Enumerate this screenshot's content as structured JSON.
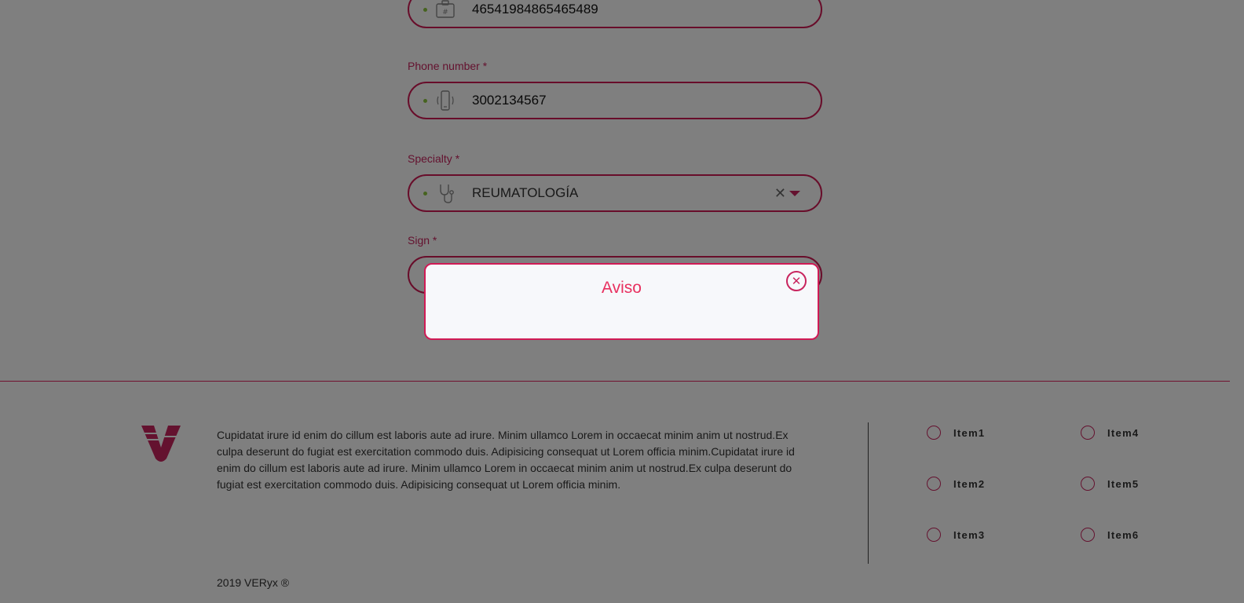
{
  "form": {
    "id_field": {
      "value": "46541984865465489",
      "icon": "id-card-icon"
    },
    "phone": {
      "label": "Phone number *",
      "value": "3002134567",
      "icon": "phone-icon"
    },
    "specialty": {
      "label": "Specialty *",
      "value": "REUMATOLOGÍA",
      "icon": "stethoscope-icon",
      "clear_glyph": "✕"
    },
    "sign": {
      "label": "Sign *"
    }
  },
  "modal": {
    "title": "Aviso",
    "close_glyph": "✕"
  },
  "footer": {
    "text": "Cupidatat irure id enim do cillum est laboris aute ad irure. Minim ullamco Lorem in occaecat minim anim ut nostrud.Ex culpa deserunt do fugiat est exercitation commodo duis. Adipisicing consequat ut Lorem officia minim.Cupidatat irure id enim do cillum est laboris aute ad irure. Minim ullamco Lorem in occaecat minim anim ut nostrud.Ex culpa deserunt do fugiat est exercitation commodo duis. Adipisicing consequat ut Lorem officia minim.",
    "items": [
      "Item1",
      "Item2",
      "Item3",
      "Item4",
      "Item5",
      "Item6"
    ],
    "copyright": "2019 VERyx ®"
  },
  "colors": {
    "accent": "#d01a55",
    "bullet": "#8cc63f",
    "modal_title": "#e8305f"
  }
}
